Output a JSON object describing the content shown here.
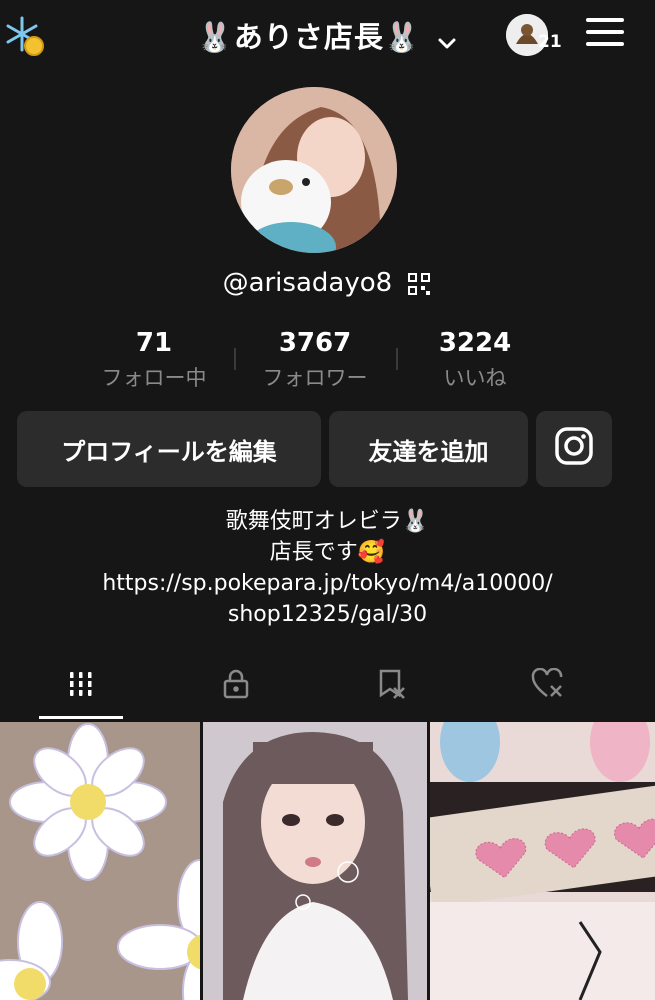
{
  "header": {
    "title": "🐰ありさ店長🐰",
    "notification_count": "21"
  },
  "profile": {
    "handle": "@arisadayo8"
  },
  "stats": [
    {
      "value": "71",
      "label": "フォロー中"
    },
    {
      "value": "3767",
      "label": "フォロワー"
    },
    {
      "value": "3224",
      "label": "いいね"
    }
  ],
  "actions": {
    "edit_label": "プロフィールを編集",
    "add_friend_label": "友達を追加"
  },
  "bio": {
    "line1": "歌舞伎町オレビラ🐰",
    "line2": "店長です🥰",
    "link_line1": "https://sp.pokepara.jp/tokyo/m4/a10000/",
    "link_line2": "shop12325/gal/30"
  },
  "tabs": [
    {
      "icon": "grid-icon",
      "active": true
    },
    {
      "icon": "lock-icon",
      "active": false
    },
    {
      "icon": "bookmark-icon",
      "active": false
    },
    {
      "icon": "liked-heart-icon",
      "active": false
    }
  ],
  "colors": {
    "background": "#161616",
    "button": "#2c2c2c",
    "muted_text": "#8a8a8a"
  }
}
